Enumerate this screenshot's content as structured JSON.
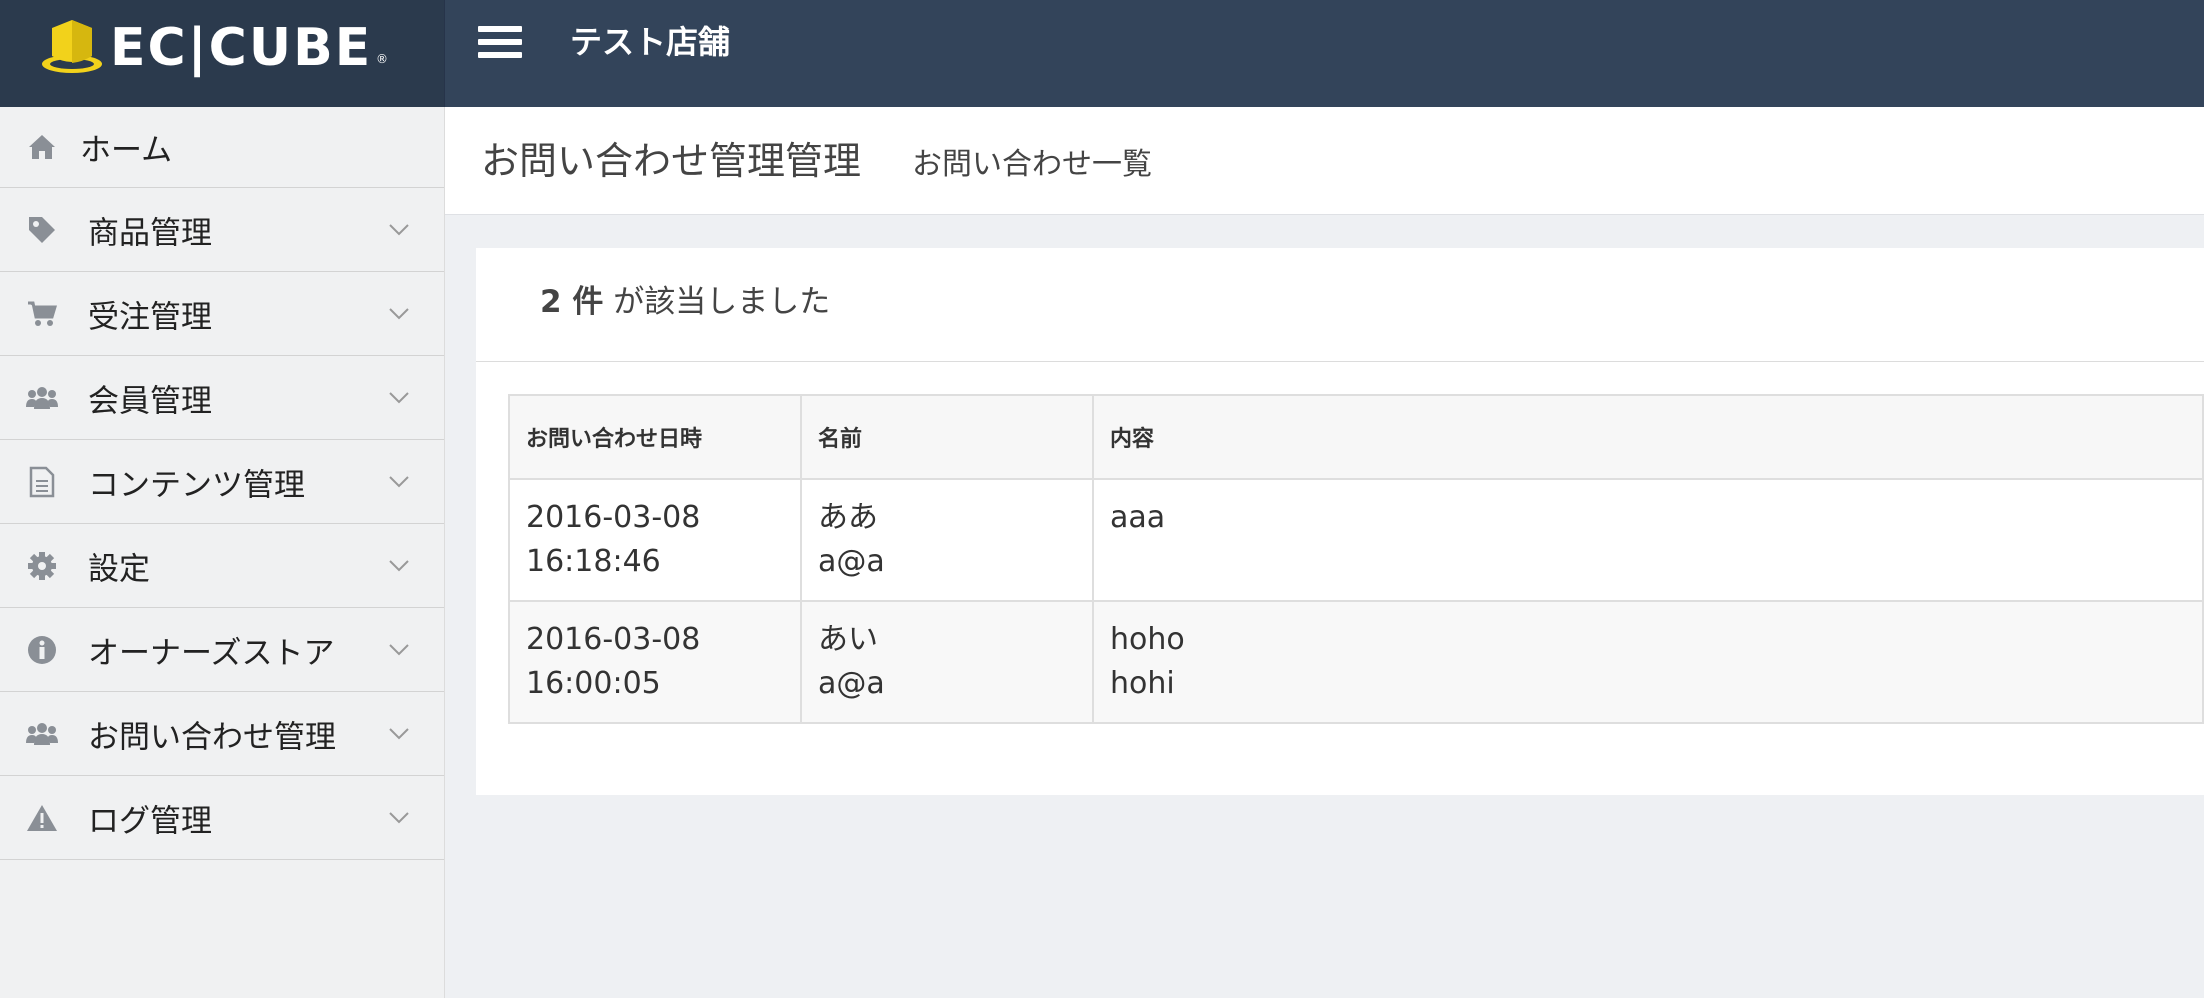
{
  "header": {
    "logo_text": "EC|CUBE",
    "logo_registered": "®",
    "shop_name": "テスト店舗"
  },
  "sidebar": {
    "items": [
      {
        "label": "ホーム",
        "icon": "home-icon"
      },
      {
        "label": "商品管理",
        "icon": "tag-icon"
      },
      {
        "label": "受注管理",
        "icon": "cart-icon"
      },
      {
        "label": "会員管理",
        "icon": "users-icon"
      },
      {
        "label": "コンテンツ管理",
        "icon": "document-icon"
      },
      {
        "label": "設定",
        "icon": "gear-icon"
      },
      {
        "label": "オーナーズストア",
        "icon": "info-icon"
      },
      {
        "label": "お問い合わせ管理",
        "icon": "users-icon"
      },
      {
        "label": "ログ管理",
        "icon": "warning-icon"
      }
    ]
  },
  "page": {
    "title": "お問い合わせ管理管理",
    "subtitle": "お問い合わせ一覧"
  },
  "results": {
    "count": "2 件",
    "suffix": " が該当しました"
  },
  "table": {
    "headers": [
      "お問い合わせ日時",
      "名前",
      "内容"
    ],
    "rows": [
      {
        "date": "2016-03-08",
        "time": "16:18:46",
        "name": "ああ",
        "email": "a@a",
        "content_line1": "aaa",
        "content_line2": ""
      },
      {
        "date": "2016-03-08",
        "time": "16:00:05",
        "name": "あい",
        "email": "a@a",
        "content_line1": "hoho",
        "content_line2": "hohi"
      }
    ]
  },
  "colors": {
    "header_bg": "#33445a",
    "logo_bg": "#2b3a4d",
    "sidebar_bg": "#f0f1f2",
    "icon_gray": "#8a8f96",
    "logo_yellow": "#f2d21b"
  }
}
